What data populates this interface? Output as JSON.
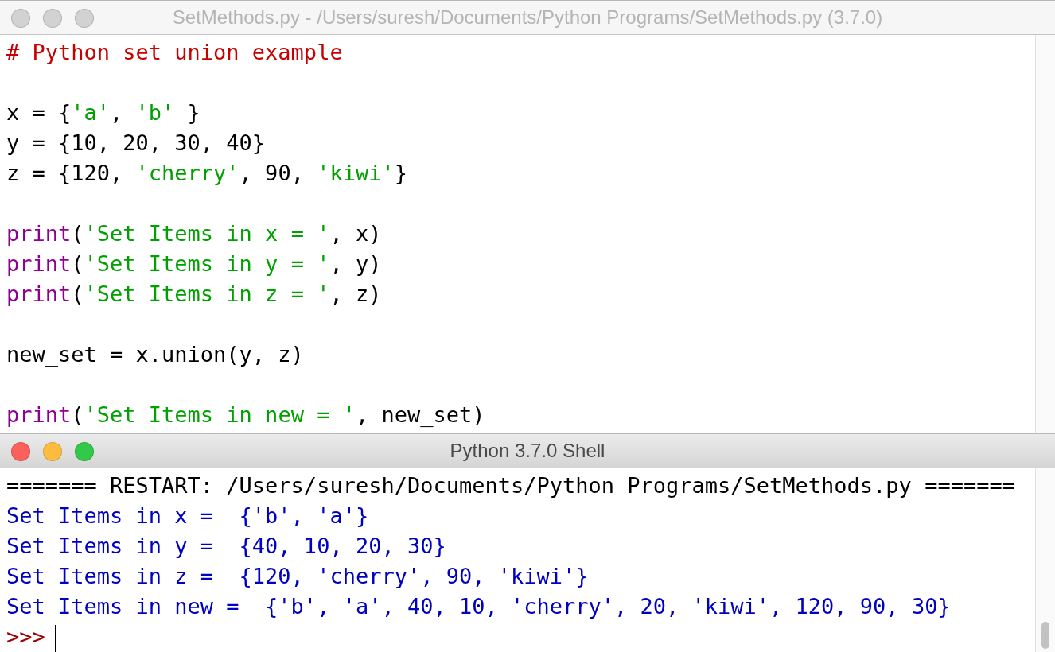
{
  "editor": {
    "title": "SetMethods.py - /Users/suresh/Documents/Python Programs/SetMethods.py (3.7.0)",
    "active": false,
    "lines": [
      {
        "kind": "code",
        "tokens": [
          {
            "kind": "comment",
            "text": "# Python set union example"
          }
        ]
      },
      {
        "kind": "blank"
      },
      {
        "kind": "code",
        "tokens": [
          {
            "kind": "plain",
            "text": "x = {"
          },
          {
            "kind": "string",
            "text": "'a'"
          },
          {
            "kind": "plain",
            "text": ", "
          },
          {
            "kind": "string",
            "text": "'b'"
          },
          {
            "kind": "plain",
            "text": " }"
          }
        ]
      },
      {
        "kind": "code",
        "tokens": [
          {
            "kind": "plain",
            "text": "y = {10, 20, 30, 40}"
          }
        ]
      },
      {
        "kind": "code",
        "tokens": [
          {
            "kind": "plain",
            "text": "z = {120, "
          },
          {
            "kind": "string",
            "text": "'cherry'"
          },
          {
            "kind": "plain",
            "text": ", 90, "
          },
          {
            "kind": "string",
            "text": "'kiwi'"
          },
          {
            "kind": "plain",
            "text": "}"
          }
        ]
      },
      {
        "kind": "blank"
      },
      {
        "kind": "code",
        "tokens": [
          {
            "kind": "builtin",
            "text": "print"
          },
          {
            "kind": "plain",
            "text": "("
          },
          {
            "kind": "string",
            "text": "'Set Items in x = '"
          },
          {
            "kind": "plain",
            "text": ", x)"
          }
        ]
      },
      {
        "kind": "code",
        "tokens": [
          {
            "kind": "builtin",
            "text": "print"
          },
          {
            "kind": "plain",
            "text": "("
          },
          {
            "kind": "string",
            "text": "'Set Items in y = '"
          },
          {
            "kind": "plain",
            "text": ", y)"
          }
        ]
      },
      {
        "kind": "code",
        "tokens": [
          {
            "kind": "builtin",
            "text": "print"
          },
          {
            "kind": "plain",
            "text": "("
          },
          {
            "kind": "string",
            "text": "'Set Items in z = '"
          },
          {
            "kind": "plain",
            "text": ", z)"
          }
        ]
      },
      {
        "kind": "blank"
      },
      {
        "kind": "code",
        "tokens": [
          {
            "kind": "plain",
            "text": "new_set = x.union(y, z)"
          }
        ]
      },
      {
        "kind": "blank"
      },
      {
        "kind": "code",
        "tokens": [
          {
            "kind": "builtin",
            "text": "print"
          },
          {
            "kind": "plain",
            "text": "("
          },
          {
            "kind": "string",
            "text": "'Set Items in new = '"
          },
          {
            "kind": "plain",
            "text": ", new_set)"
          }
        ]
      }
    ]
  },
  "shell": {
    "title": "Python 3.7.0 Shell",
    "active": true,
    "lines": [
      {
        "kind": "restart",
        "text": "======= RESTART: /Users/suresh/Documents/Python Programs/SetMethods.py ======="
      },
      {
        "kind": "output",
        "text": "Set Items in x =  {'b', 'a'}"
      },
      {
        "kind": "output",
        "text": "Set Items in y =  {40, 10, 20, 30}"
      },
      {
        "kind": "output",
        "text": "Set Items in z =  {120, 'cherry', 90, 'kiwi'}"
      },
      {
        "kind": "output",
        "text": "Set Items in new =  {'b', 'a', 40, 10, 'cherry', 20, 'kiwi', 120, 90, 30}"
      }
    ],
    "prompt": ">>>"
  }
}
